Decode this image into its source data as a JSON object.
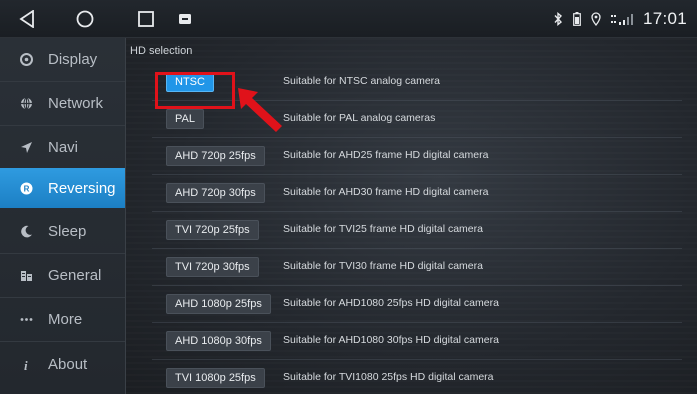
{
  "statusbar": {
    "time": "17:01",
    "nav": [
      "back-icon",
      "home-icon",
      "recents-icon",
      "notification-icon"
    ],
    "status_icons": [
      "bluetooth-icon",
      "battery-icon",
      "location-icon",
      "signal-icon"
    ]
  },
  "sidebar": {
    "items": [
      {
        "label": "Display",
        "icon": "display-icon"
      },
      {
        "label": "Network",
        "icon": "globe-icon"
      },
      {
        "label": "Navi",
        "icon": "navigation-icon"
      },
      {
        "label": "Reversing",
        "icon": "reversing-icon",
        "active": true
      },
      {
        "label": "Sleep",
        "icon": "moon-icon"
      },
      {
        "label": "General",
        "icon": "general-icon"
      },
      {
        "label": "More",
        "icon": "more-icon"
      },
      {
        "label": "About",
        "icon": "info-icon"
      }
    ]
  },
  "main": {
    "section_title": "HD selection",
    "options": [
      {
        "label": "NTSC",
        "desc": "Suitable for NTSC analog camera",
        "selected": true
      },
      {
        "label": "PAL",
        "desc": "Suitable for PAL analog cameras"
      },
      {
        "label": "AHD 720p 25fps",
        "desc": "Suitable for AHD25 frame HD digital camera"
      },
      {
        "label": "AHD 720p 30fps",
        "desc": "Suitable for AHD30 frame HD digital camera"
      },
      {
        "label": "TVI 720p 25fps",
        "desc": "Suitable for TVI25 frame HD digital camera"
      },
      {
        "label": "TVI 720p 30fps",
        "desc": "Suitable for TVI30 frame HD digital camera"
      },
      {
        "label": "AHD 1080p 25fps",
        "desc": "Suitable for AHD1080 25fps HD digital camera"
      },
      {
        "label": "AHD 1080p 30fps",
        "desc": "Suitable for AHD1080 30fps HD digital camera"
      },
      {
        "label": "TVI 1080p 25fps",
        "desc": "Suitable for TVI1080 25fps HD digital camera"
      }
    ]
  },
  "colors": {
    "accent": "#2196e8",
    "annotation": "#e0121a"
  }
}
